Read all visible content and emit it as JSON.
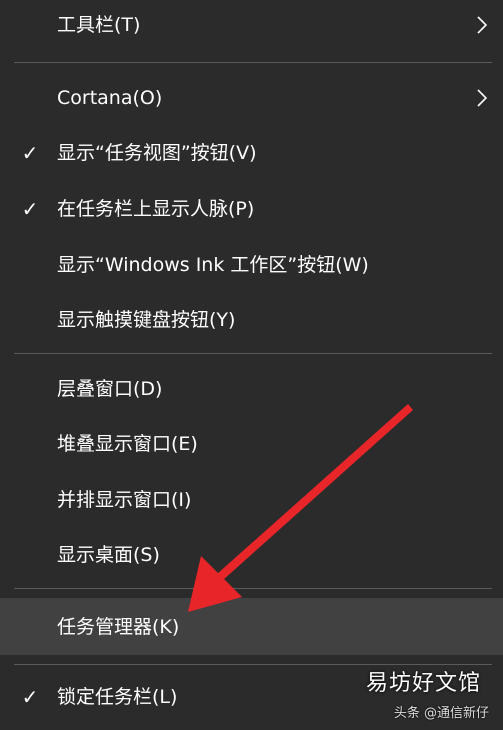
{
  "menu": {
    "items": [
      {
        "label": "工具栏(T)",
        "checked": false,
        "submenu": true
      },
      {
        "label": "Cortana(O)",
        "checked": false,
        "submenu": true
      },
      {
        "label": "显示“任务视图”按钮(V)",
        "checked": true,
        "submenu": false
      },
      {
        "label": "在任务栏上显示人脉(P)",
        "checked": true,
        "submenu": false
      },
      {
        "label": "显示“Windows Ink 工作区”按钮(W)",
        "checked": false,
        "submenu": false
      },
      {
        "label": "显示触摸键盘按钮(Y)",
        "checked": false,
        "submenu": false
      },
      {
        "label": "层叠窗口(D)",
        "checked": false,
        "submenu": false
      },
      {
        "label": "堆叠显示窗口(E)",
        "checked": false,
        "submenu": false
      },
      {
        "label": "并排显示窗口(I)",
        "checked": false,
        "submenu": false
      },
      {
        "label": "显示桌面(S)",
        "checked": false,
        "submenu": false
      },
      {
        "label": "任务管理器(K)",
        "checked": false,
        "submenu": false,
        "highlighted": true
      },
      {
        "label": "锁定任务栏(L)",
        "checked": true,
        "submenu": false
      }
    ],
    "check_glyph": "✓"
  },
  "colors": {
    "background": "#2b2b2b",
    "highlight": "#414141",
    "separator": "#5a5a5a",
    "text": "#ffffff",
    "arrow": "#e8262a"
  },
  "watermark": {
    "main": "易坊好文馆",
    "sub": "头条 @通信新仔"
  }
}
